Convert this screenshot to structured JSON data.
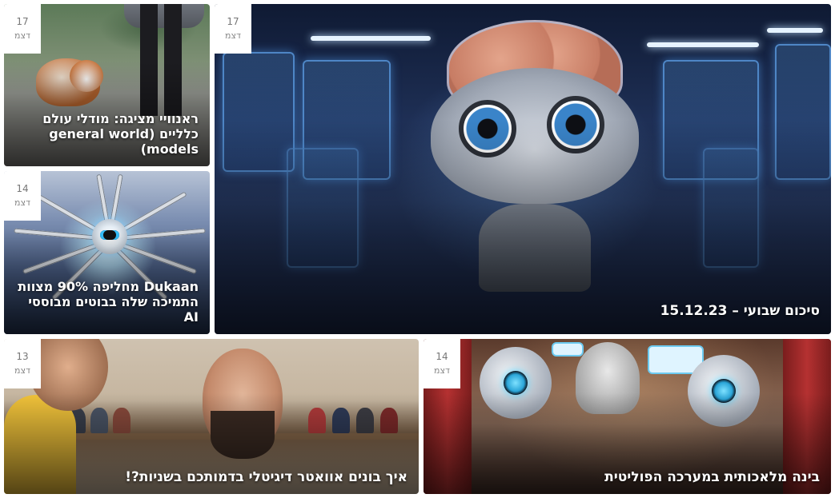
{
  "cards": [
    {
      "date_day": "17",
      "date_month": "דצמ",
      "title": "ראנוויי מציגה: מודלי עולם כלליים (general world models)"
    },
    {
      "date_day": "14",
      "date_month": "דצמ",
      "title": "Dukaan מחליפה 90% מצוות התמיכה שלה בבוטים מבוססי AI"
    },
    {
      "date_day": "17",
      "date_month": "דצמ",
      "title": "סיכום שבועי – 15.12.23"
    },
    {
      "date_day": "13",
      "date_month": "דצמ",
      "title": "איך בונים אוואטר דיגיטלי בדמותכם בשניות?!"
    },
    {
      "date_day": "14",
      "date_month": "דצמ",
      "title": "בינה מלאכותית במערכה הפוליטית"
    }
  ]
}
